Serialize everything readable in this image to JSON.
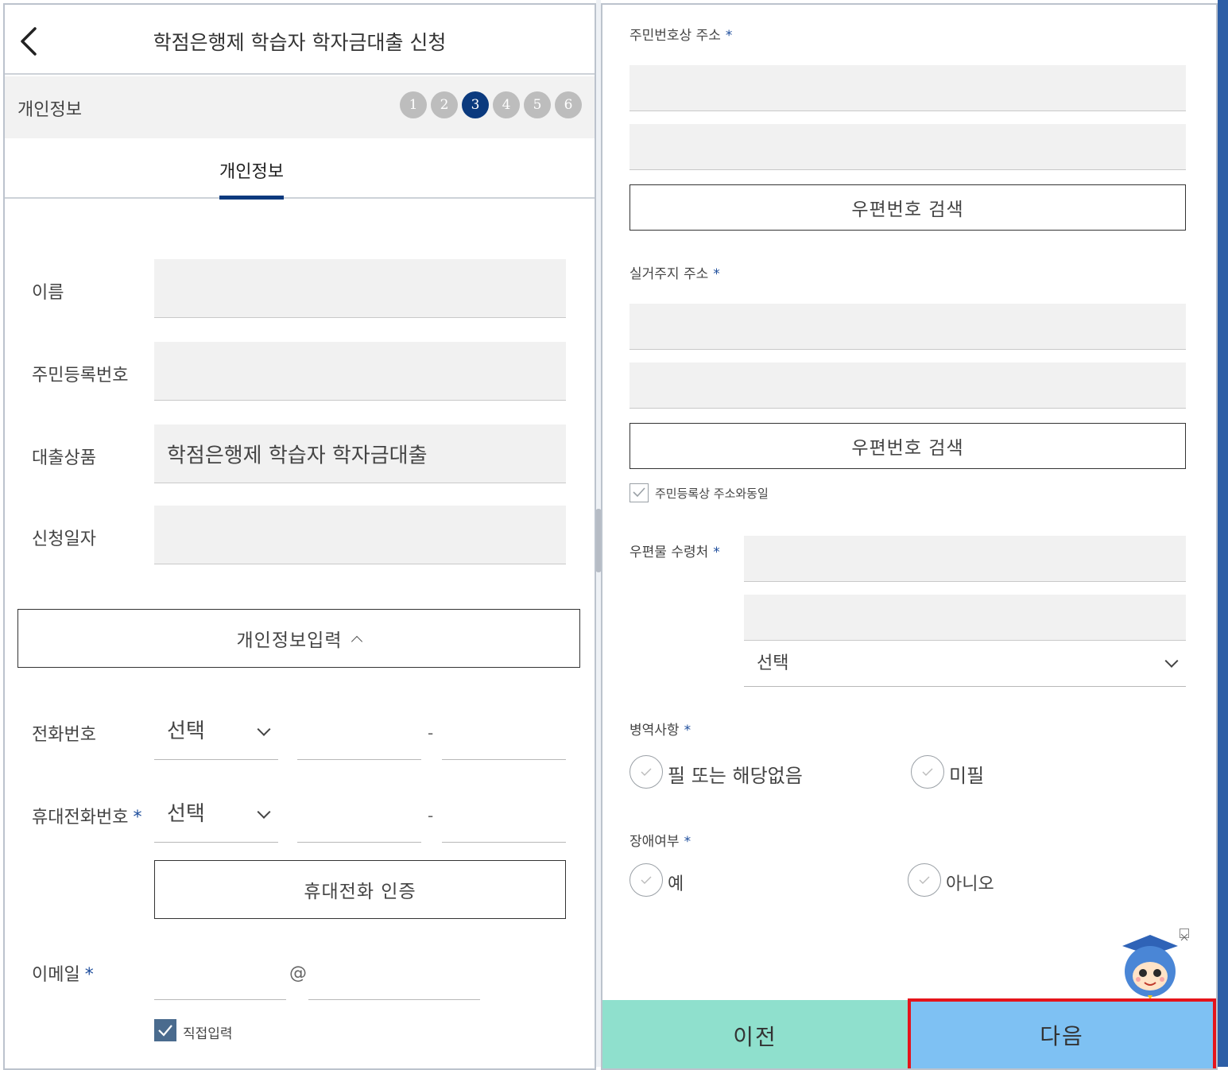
{
  "header": {
    "title": "학점은행제 학습자 학자금대출 신청"
  },
  "steps": {
    "section_label": "개인정보",
    "items": [
      "1",
      "2",
      "3",
      "4",
      "5",
      "6"
    ],
    "active": "3"
  },
  "tab": {
    "label": "개인정보"
  },
  "fields": {
    "name_label": "이름",
    "rrn_label": "주민등록번호",
    "product_label": "대출상품",
    "product_value": "학점은행제 학습자 학자금대출",
    "date_label": "신청일자"
  },
  "personal_input_button": "개인정보입력",
  "phone": {
    "label": "전화번호",
    "select": "선택",
    "sep": "-"
  },
  "mobile": {
    "label": "휴대전화번호",
    "required": "*",
    "select": "선택",
    "sep": "-"
  },
  "mobile_auth_button": "휴대전화 인증",
  "email": {
    "label": "이메일",
    "required": "*",
    "at": "@",
    "direct_input": "직접입력"
  },
  "right": {
    "reg_addr_label": "주민번호상 주소",
    "zip_search": "우편번호 검색",
    "real_addr_label": "실거주지 주소",
    "same_as_reg": "주민등록상 주소와동일",
    "mail_recv_label": "우편물 수령처",
    "mail_select": "선택",
    "military_label": "병역사항",
    "military_opt1": "필 또는 해당없음",
    "military_opt2": "미필",
    "disability_label": "장애여부",
    "disability_yes": "예",
    "disability_no": "아니오",
    "required": "*"
  },
  "nav": {
    "prev": "이전",
    "next": "다음"
  },
  "colors": {
    "primary": "#0b3a7e",
    "prev_bg": "#8fe0cd",
    "next_bg": "#7ec1f3",
    "highlight": "#e5141b"
  }
}
